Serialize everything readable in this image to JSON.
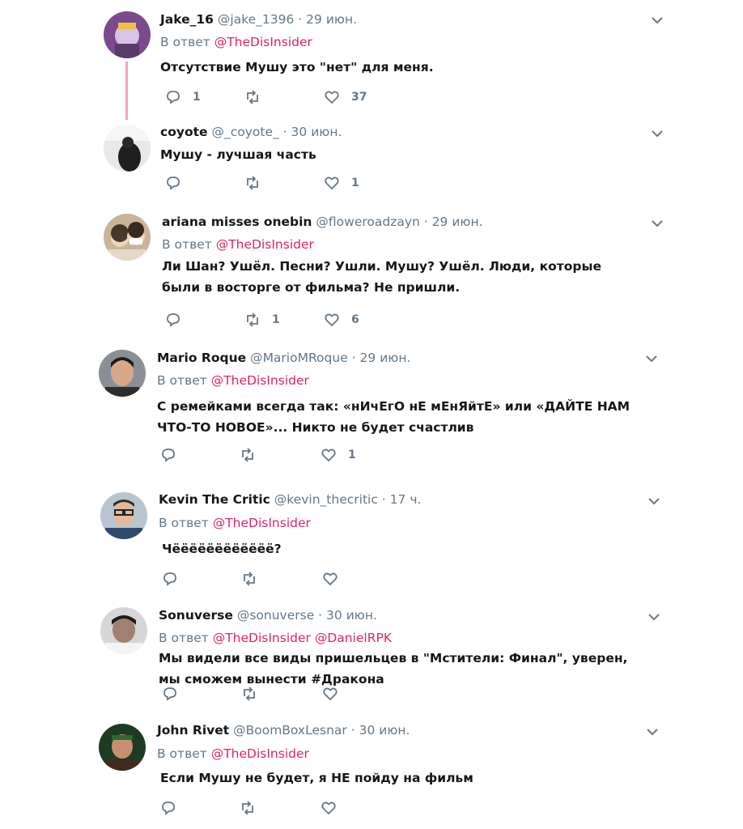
{
  "tweets": [
    {
      "name": "Jake_16",
      "handle": "@jake_1396",
      "time": "29 июн.",
      "reply_prefix": "В ответ",
      "mentions": [
        "@TheDisInsider"
      ],
      "text": "Отсутствие Мушу это \"нет\" для меня.",
      "replies": "1",
      "retweets": "",
      "likes": "37"
    },
    {
      "name": "coyote",
      "handle": "@_coyote_",
      "time": "30 июн.",
      "reply_prefix": "",
      "mentions": [],
      "text": "Мушу - лучшая часть",
      "replies": "",
      "retweets": "",
      "likes": "1"
    },
    {
      "name": "ariana misses onebin",
      "handle": "@floweroadzayn",
      "time": "29 июн.",
      "reply_prefix": "В ответ",
      "mentions": [
        "@TheDisInsider"
      ],
      "text": "Ли Шан? Ушёл. Песни? Ушли. Мушу? Ушёл. Люди, которые были в восторге от фильма? Не пришли.",
      "replies": "",
      "retweets": "1",
      "likes": "6"
    },
    {
      "name": "Mario Roque",
      "handle": "@MarioMRoque",
      "time": "29 июн.",
      "reply_prefix": "В ответ",
      "mentions": [
        "@TheDisInsider"
      ],
      "text": "С ремейками всегда так: «нИчЕгО нЕ мЕнЯйтЕ» или «ДАЙТЕ НАМ ЧТО-ТО НОВОЕ»... Никто не будет счастлив",
      "replies": "",
      "retweets": "",
      "likes": "1"
    },
    {
      "name": "Kevin The Critic",
      "handle": "@kevin_thecritic",
      "time": "17 ч.",
      "reply_prefix": "В ответ",
      "mentions": [
        "@TheDisInsider"
      ],
      "text": "Чёёёёёёёёёёёё?",
      "replies": "",
      "retweets": "",
      "likes": ""
    },
    {
      "name": "Sonuverse",
      "handle": "@sonuverse",
      "time": "30 июн.",
      "reply_prefix": "В ответ",
      "mentions": [
        "@TheDisInsider",
        "@DanielRPK"
      ],
      "text": "Мы видели все виды пришельцев в \"Мстители: Финал\", уверен, мы сможем вынести #Дракона",
      "replies": "",
      "retweets": "",
      "likes": ""
    },
    {
      "name": "John Rivet",
      "handle": "@BoomBoxLesnar",
      "time": "30 июн.",
      "reply_prefix": "В ответ",
      "mentions": [
        "@TheDisInsider"
      ],
      "text": "Если Мушу не будет, я НЕ пойду на фильм",
      "replies": "",
      "retweets": "",
      "likes": ""
    }
  ],
  "separator": "·",
  "colors": {
    "mention": "#e0245e",
    "muted": "#657786",
    "thread": "#f7a1c4"
  },
  "icons": {
    "reply": "reply-icon",
    "retweet": "retweet-icon",
    "like": "heart-icon",
    "menu": "chevron-down-icon"
  }
}
